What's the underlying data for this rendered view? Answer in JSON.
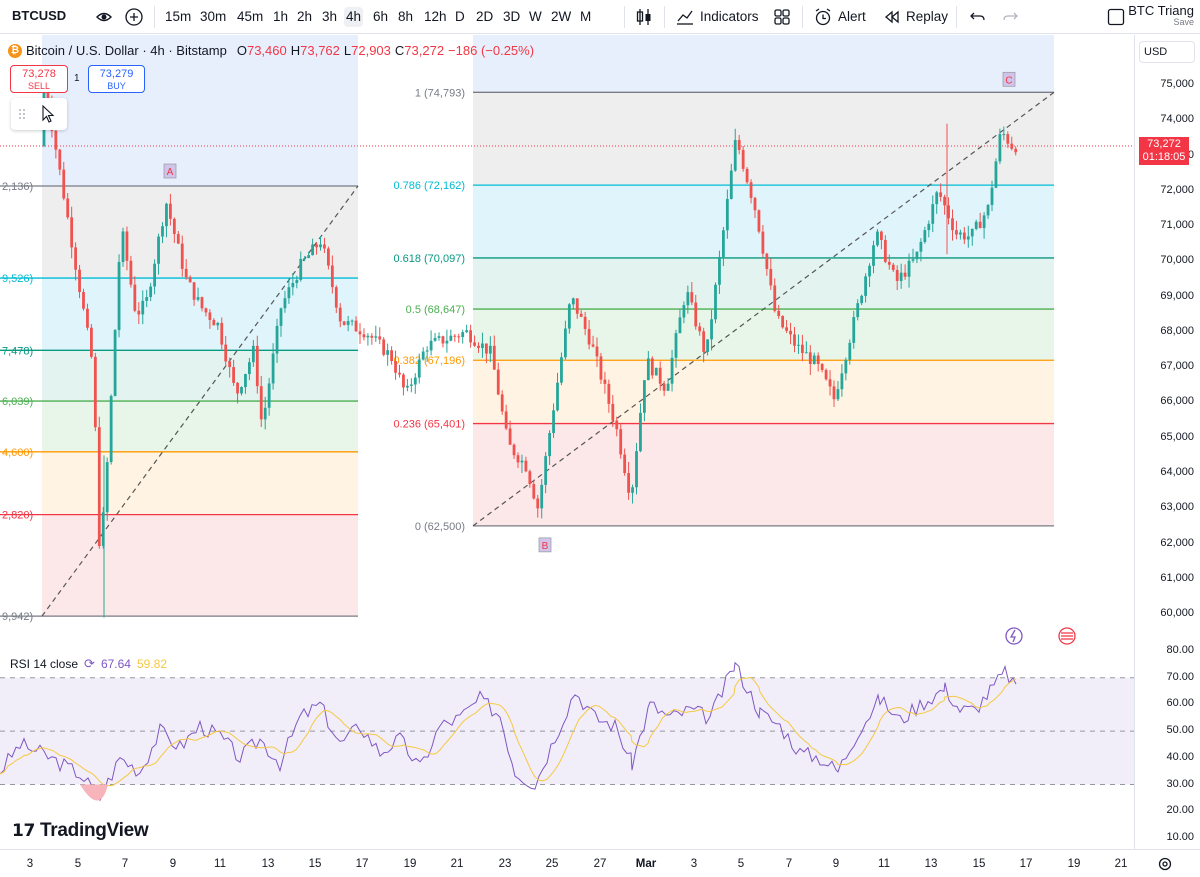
{
  "toolbar": {
    "symbol": "BTCUSD",
    "intervals": [
      "15m",
      "30m",
      "45m",
      "1h",
      "2h",
      "3h",
      "4h",
      "6h",
      "8h",
      "12h",
      "D",
      "2D",
      "3D",
      "W",
      "2W",
      "M"
    ],
    "active_interval": "4h",
    "indicators_label": "Indicators",
    "alert_label": "Alert",
    "replay_label": "Replay",
    "layout_title": "BTC Triang",
    "save_label": "Save"
  },
  "legend": {
    "title": "Bitcoin / U.S. Dollar · 4h · Bitstamp",
    "open_label": "O",
    "open": "73,460",
    "high_label": "H",
    "high": "73,762",
    "low_label": "L",
    "low": "72,903",
    "close_label": "C",
    "close": "73,272",
    "change": "−186 (−0.25%)"
  },
  "trade": {
    "sell_price": "73,278",
    "sell_label": "SELL",
    "buy_price": "73,279",
    "buy_label": "BUY",
    "quantity": "1"
  },
  "currency": "USD",
  "price_axis": [
    "75,000",
    "74,000",
    "73,000",
    "72,000",
    "71,000",
    "70,000",
    "69,000",
    "68,000",
    "67,000",
    "66,000",
    "65,000",
    "64,000",
    "63,000",
    "62,000",
    "61,000",
    "60,000"
  ],
  "current_price": "73,272",
  "countdown": "01:18:05",
  "time_axis": [
    "3",
    "5",
    "7",
    "9",
    "11",
    "13",
    "15",
    "17",
    "19",
    "21",
    "23",
    "25",
    "27",
    "Mar",
    "3",
    "5",
    "7",
    "9",
    "11",
    "13",
    "15",
    "17",
    "19",
    "21"
  ],
  "points": {
    "a": "A",
    "b": "B",
    "c": "C"
  },
  "fib_left_labels": [
    "2,136)",
    "9,526)",
    "7,478)",
    "6,039)",
    "4,600)",
    "2,820)",
    "9,942)"
  ],
  "fib_right_labels": [
    "1 (74,793)",
    "0.786 (72,162)",
    "0.618 (70,097)",
    "0.5 (68,647)",
    "0.382 (67,196)",
    "0.236 (65,401)",
    "0 (62,500)"
  ],
  "rsi": {
    "label": "RSI 14 close",
    "value": "67.64",
    "ma_value": "59.82",
    "axis": [
      "80.00",
      "70.00",
      "60.00",
      "50.00",
      "40.00",
      "30.00",
      "20.00",
      "10.00"
    ]
  },
  "watermark": "TradingView",
  "colors": {
    "up": "#26a69a",
    "down": "#ef5350",
    "rsi": "#7e57c2",
    "rsi_ma": "#f5c842",
    "fib_236": "#f23645",
    "fib_382": "#ff9800",
    "fib_5": "#4caf50",
    "fib_618": "#089981",
    "fib_786": "#00bcd4"
  }
}
